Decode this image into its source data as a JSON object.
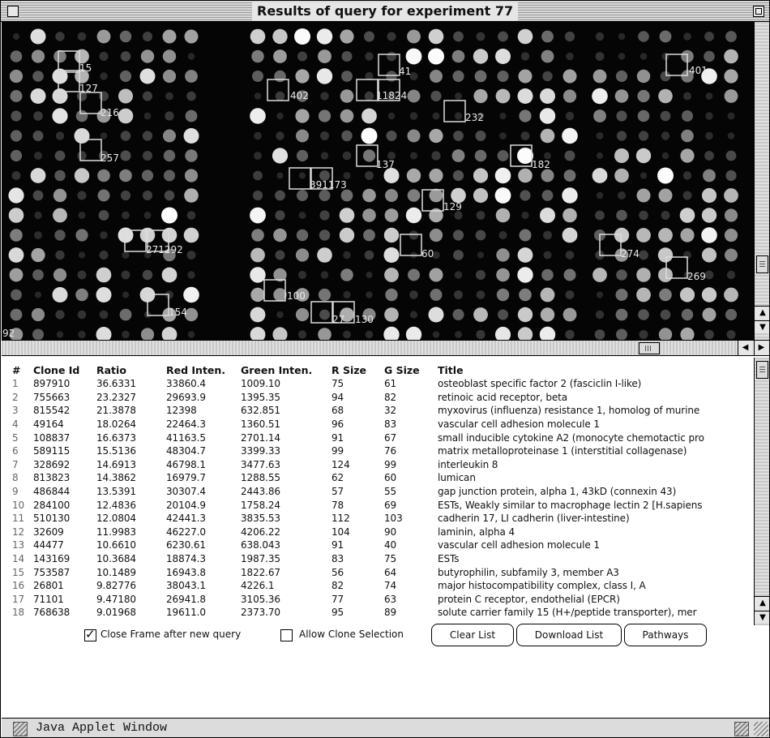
{
  "window": {
    "title": "Results of query for experiment 77"
  },
  "array": {
    "spot_labels": [
      "15",
      "127",
      "216",
      "257",
      "271292",
      "154",
      "92",
      "402",
      "41",
      "11824",
      "232",
      "137",
      "391173",
      "129",
      "182",
      "401",
      "60",
      "274",
      "269",
      "100",
      "27",
      "130"
    ]
  },
  "table": {
    "headers": {
      "idx": "#",
      "clone": "Clone Id",
      "ratio": "Ratio",
      "red": "Red Inten.",
      "green": "Green Inten.",
      "rsize": "R Size",
      "gsize": "G Size",
      "title": "Title"
    },
    "rows": [
      {
        "idx": "1",
        "clone": "897910",
        "ratio": "36.6331",
        "red": "33860.4",
        "green": "1009.10",
        "rsize": "75",
        "gsize": "61",
        "title": "osteoblast specific factor 2 (fasciclin I-like)"
      },
      {
        "idx": "2",
        "clone": "755663",
        "ratio": "23.2327",
        "red": "29693.9",
        "green": "1395.35",
        "rsize": "94",
        "gsize": "82",
        "title": "retinoic acid receptor, beta"
      },
      {
        "idx": "3",
        "clone": "815542",
        "ratio": "21.3878",
        "red": "12398",
        "green": "632.851",
        "rsize": "68",
        "gsize": "32",
        "title": "myxovirus (influenza) resistance 1, homolog of murine"
      },
      {
        "idx": "4",
        "clone": "49164",
        "ratio": "18.0264",
        "red": "22464.3",
        "green": "1360.51",
        "rsize": "96",
        "gsize": "83",
        "title": "vascular cell adhesion molecule 1"
      },
      {
        "idx": "5",
        "clone": "108837",
        "ratio": "16.6373",
        "red": "41163.5",
        "green": "2701.14",
        "rsize": "91",
        "gsize": "67",
        "title": "small inducible cytokine A2 (monocyte chemotactic pro"
      },
      {
        "idx": "6",
        "clone": "589115",
        "ratio": "15.5136",
        "red": "48304.7",
        "green": "3399.33",
        "rsize": "99",
        "gsize": "76",
        "title": "matrix metalloproteinase 1 (interstitial collagenase)"
      },
      {
        "idx": "7",
        "clone": "328692",
        "ratio": "14.6913",
        "red": "46798.1",
        "green": "3477.63",
        "rsize": "124",
        "gsize": "99",
        "title": "interleukin 8"
      },
      {
        "idx": "8",
        "clone": "813823",
        "ratio": "14.3862",
        "red": "16979.7",
        "green": "1288.55",
        "rsize": "62",
        "gsize": "60",
        "title": "lumican"
      },
      {
        "idx": "9",
        "clone": "486844",
        "ratio": "13.5391",
        "red": "30307.4",
        "green": "2443.86",
        "rsize": "57",
        "gsize": "55",
        "title": "gap junction protein, alpha 1, 43kD (connexin 43)"
      },
      {
        "idx": "10",
        "clone": "284100",
        "ratio": "12.4836",
        "red": "20104.9",
        "green": "1758.24",
        "rsize": "78",
        "gsize": "69",
        "title": "ESTs, Weakly similar to macrophage lectin 2 [H.sapiens"
      },
      {
        "idx": "11",
        "clone": "510130",
        "ratio": "12.0804",
        "red": "42441.3",
        "green": "3835.53",
        "rsize": "112",
        "gsize": "103",
        "title": "cadherin 17, LI cadherin (liver-intestine)"
      },
      {
        "idx": "12",
        "clone": "32609",
        "ratio": "11.9983",
        "red": "46227.0",
        "green": "4206.22",
        "rsize": "104",
        "gsize": "90",
        "title": "laminin, alpha 4"
      },
      {
        "idx": "13",
        "clone": "44477",
        "ratio": "10.6610",
        "red": "6230.61",
        "green": "638.043",
        "rsize": "91",
        "gsize": "40",
        "title": "vascular cell adhesion molecule 1"
      },
      {
        "idx": "14",
        "clone": "143169",
        "ratio": "10.3684",
        "red": "18874.3",
        "green": "1987.35",
        "rsize": "83",
        "gsize": "75",
        "title": "ESTs"
      },
      {
        "idx": "15",
        "clone": "753587",
        "ratio": "10.1489",
        "red": "16943.8",
        "green": "1822.67",
        "rsize": "56",
        "gsize": "64",
        "title": "butyrophilin, subfamily 3, member A3"
      },
      {
        "idx": "16",
        "clone": "26801",
        "ratio": "9.82776",
        "red": "38043.1",
        "green": "4226.1",
        "rsize": "82",
        "gsize": "74",
        "title": "major histocompatibility complex, class I, A"
      },
      {
        "idx": "17",
        "clone": "71101",
        "ratio": "9.47180",
        "red": "26941.8",
        "green": "3105.36",
        "rsize": "77",
        "gsize": "63",
        "title": "protein C receptor, endothelial (EPCR)"
      },
      {
        "idx": "18",
        "clone": "768638",
        "ratio": "9.01968",
        "red": "19611.0",
        "green": "2373.70",
        "rsize": "95",
        "gsize": "89",
        "title": "solute carrier family 15 (H+/peptide transporter), mer"
      }
    ]
  },
  "controls": {
    "close_frame": {
      "label": "Close Frame after new query",
      "checked": true
    },
    "allow_selection": {
      "label": "Allow Clone Selection",
      "checked": false
    },
    "clear_list": "Clear List",
    "download_list": "Download List",
    "pathways": "Pathways"
  },
  "status": {
    "text": "Java Applet Window"
  }
}
